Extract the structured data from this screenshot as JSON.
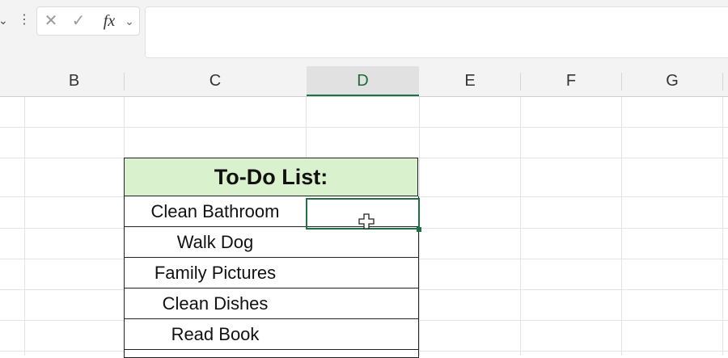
{
  "formula_bar": {
    "namebox_arrow": "⌄",
    "more_icon": "⋮",
    "cancel_icon": "✕",
    "enter_icon": "✓",
    "fx_label": "fx",
    "expand_icon": "⌄",
    "formula_value": ""
  },
  "columns": [
    "B",
    "C",
    "D",
    "E",
    "F",
    "G"
  ],
  "selected_column": "D",
  "todo": {
    "title": "To-Do List:",
    "items": [
      "Clean Bathroom",
      "Walk Dog",
      "Family Pictures",
      "Clean Dishes",
      "Read Book"
    ]
  },
  "colors": {
    "header_fill": "#d9f1cc",
    "selection": "#1e7145"
  },
  "cursor": "cross-cursor-icon"
}
